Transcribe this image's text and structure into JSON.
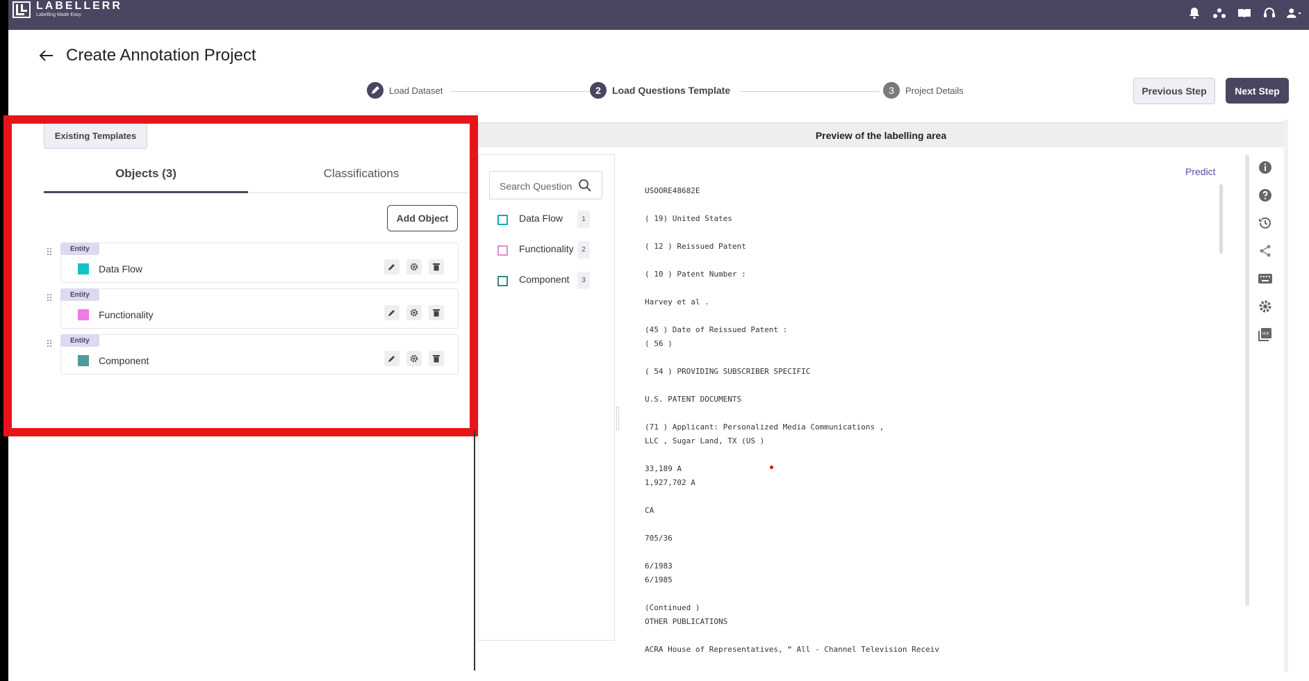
{
  "app": {
    "brand": "LABELLERR",
    "tagline": "Labelling Made Easy"
  },
  "header_icons": [
    "bell-icon",
    "org-icon",
    "book-icon",
    "support-icon",
    "user-icon"
  ],
  "page": {
    "title": "Create Annotation Project"
  },
  "stepper": {
    "steps": [
      {
        "num": "",
        "label": "Load Dataset",
        "state": "done"
      },
      {
        "num": "2",
        "label": "Load Questions Template",
        "state": "active"
      },
      {
        "num": "3",
        "label": "Project Details",
        "state": "todo"
      }
    ]
  },
  "actions": {
    "previous": "Previous Step",
    "next": "Next Step"
  },
  "left_panel": {
    "existing_templates": "Existing Templates",
    "tabs": {
      "objects": "Objects (3)",
      "classifications": "Classifications"
    },
    "add_object": "Add Object",
    "objects": [
      {
        "tag": "Entity",
        "name": "Data Flow",
        "color": "#14c3c9"
      },
      {
        "tag": "Entity",
        "name": "Functionality",
        "color": "#f07ae6"
      },
      {
        "tag": "Entity",
        "name": "Component",
        "color": "#4f9b9b"
      }
    ]
  },
  "preview": {
    "title": "Preview of the labelling area",
    "search_placeholder": "Search Question",
    "questions": [
      {
        "label": "Data Flow",
        "count": "1",
        "color": "#14a8b0"
      },
      {
        "label": "Functionality",
        "count": "2",
        "color": "#e28ad6"
      },
      {
        "label": "Component",
        "count": "3",
        "color": "#3f8080"
      }
    ],
    "predict": "Predict",
    "document_lines": [
      "USOORE48682E",
      "( 19) United States",
      "( 12 ) Reissued Patent",
      "( 10 ) Patent Number :",
      "Harvey et al .",
      "(45 ) Date of Reissued Patent :",
      "( 56 )",
      "( 54 ) PROVIDING SUBSCRIBER SPECIFIC",
      "U.S. PATENT DOCUMENTS",
      "(71 ) Applicant: Personalized Media Communications ,",
      "LLC , Sugar Land, TX (US )",
      "33,189 A",
      "1,927,702 A",
      "CA",
      "705/36",
      "6/1983",
      "6/1985",
      "(Continued )",
      "OTHER PUBLICATIONS",
      "ACRA House of Representatives, “ All - Channel Television Receiv"
    ]
  },
  "side_tools": [
    "info-icon",
    "help-icon",
    "history-icon",
    "share-icon",
    "keyboard-icon",
    "settings-icon",
    "pdf-icon"
  ]
}
